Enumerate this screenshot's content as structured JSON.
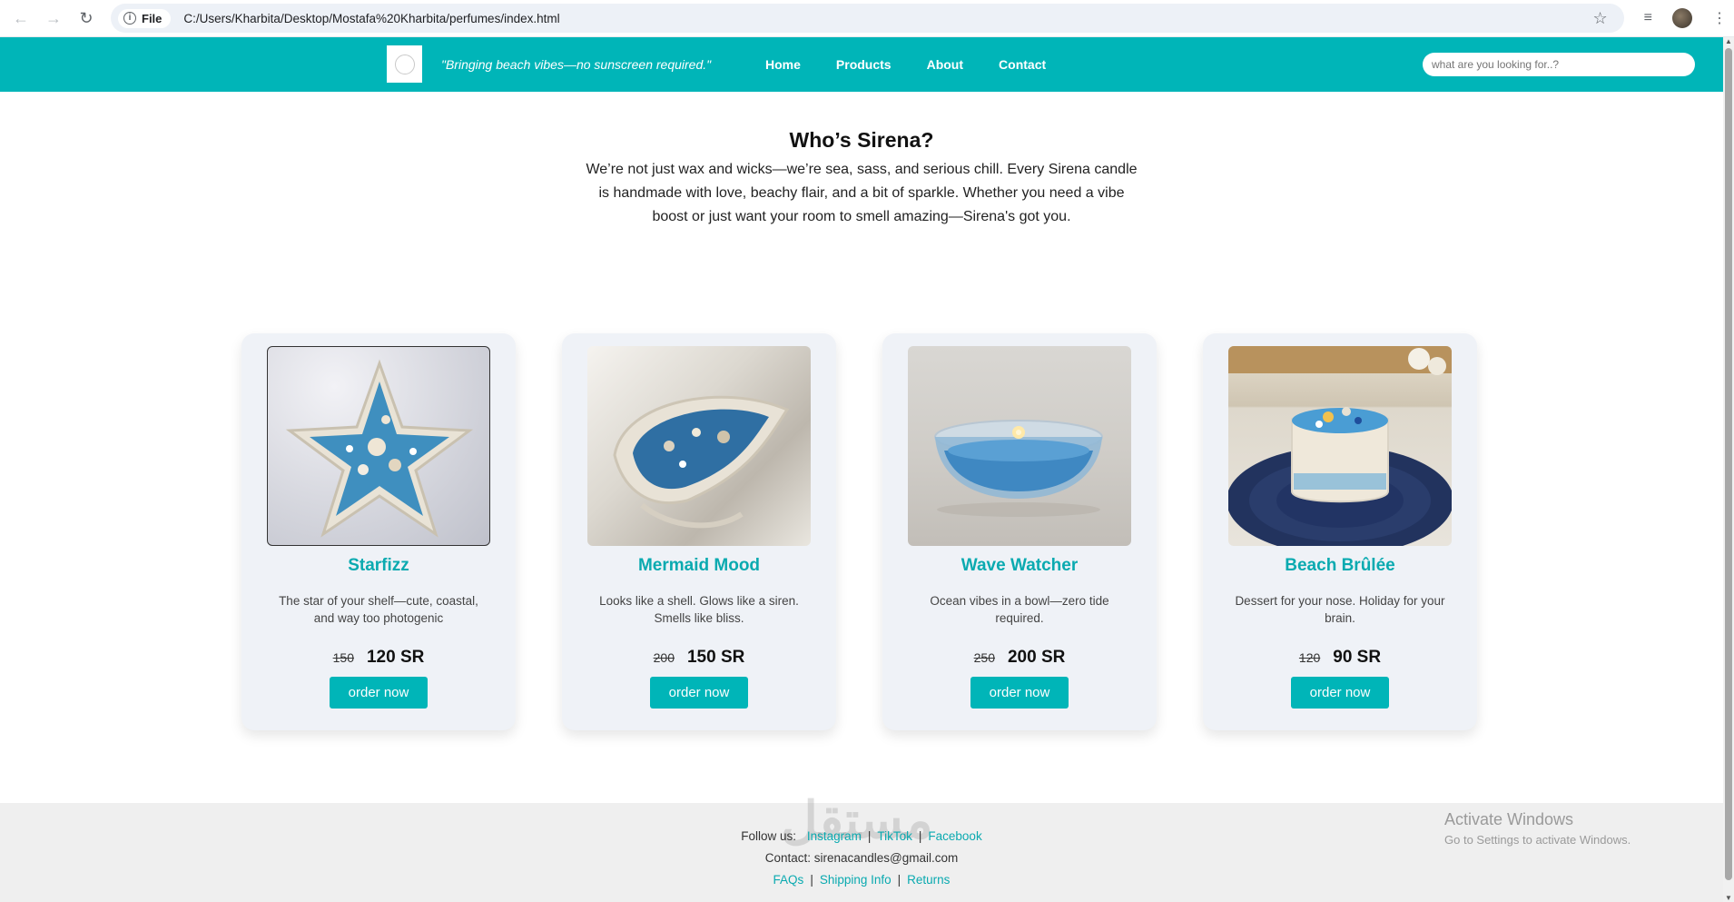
{
  "browser": {
    "site_chip": "File",
    "url": "C:/Users/Kharbita/Desktop/Mostafa%20Kharbita/perfumes/index.html"
  },
  "header": {
    "tagline": "\"Bringing beach vibes—no sunscreen required.\"",
    "menu": [
      "Home",
      "Products",
      "About",
      "Contact"
    ],
    "search_placeholder": "what are you looking for..?"
  },
  "about": {
    "title": "Who’s Sirena?",
    "text": "We’re not just wax and wicks—we’re sea, sass, and serious chill. Every Sirena candle is handmade with love, beachy flair, and a bit of sparkle. Whether you need a vibe boost or just want your room to smell amazing—Sirena's got you."
  },
  "products": [
    {
      "name": "Starfizz",
      "desc": "The star of your shelf—cute, coastal, and way too photogenic",
      "old_price": "150",
      "new_price": "120 SR",
      "button": "order now"
    },
    {
      "name": "Mermaid Mood",
      "desc": "Looks like a shell. Glows like a siren. Smells like bliss.",
      "old_price": "200",
      "new_price": "150 SR",
      "button": "order now"
    },
    {
      "name": "Wave Watcher",
      "desc": "Ocean vibes in a bowl—zero tide required.",
      "old_price": "250",
      "new_price": "200 SR",
      "button": "order now"
    },
    {
      "name": "Beach Brûlée",
      "desc": "Dessert for your nose. Holiday for your brain.",
      "old_price": "120",
      "new_price": "90 SR",
      "button": "order now"
    }
  ],
  "footer": {
    "follow_label": "Follow us:",
    "socials": [
      "Instagram",
      "TikTok",
      "Facebook"
    ],
    "contact": "Contact: sirenacandles@gmail.com",
    "links": [
      "FAQs",
      "Shipping Info",
      "Returns"
    ],
    "watermark": "مستقل",
    "activate_title": "Activate Windows",
    "activate_sub": "Go to Settings to activate Windows."
  },
  "colors": {
    "brand_teal": "#00b5b8",
    "card_bg": "#eff2f7",
    "footer_bg": "#efefef"
  }
}
